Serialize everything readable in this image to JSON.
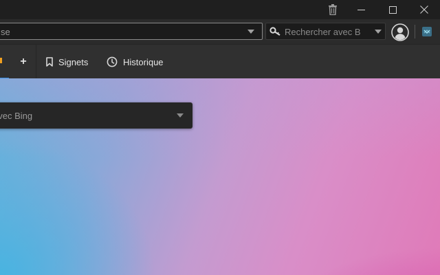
{
  "titlebar": {
    "buttons": [
      "trash",
      "minimize",
      "maximize",
      "close"
    ]
  },
  "toolbar": {
    "url_value": "se",
    "search_placeholder": "Rechercher avec Bi",
    "profile_icon": "user-circle-icon",
    "extension_icon": "extension-icon"
  },
  "tabs": {
    "new_tab_label": "+",
    "bookmarks_label": "Signets",
    "history_label": "Historique"
  },
  "content": {
    "search_engine_value": "avec Bing"
  },
  "colors": {
    "accent_blue": "#3a8ee6",
    "accent_orange": "#f0a020",
    "gradient_blue": "#4cb4dc",
    "gradient_pink": "#d94ca8"
  }
}
